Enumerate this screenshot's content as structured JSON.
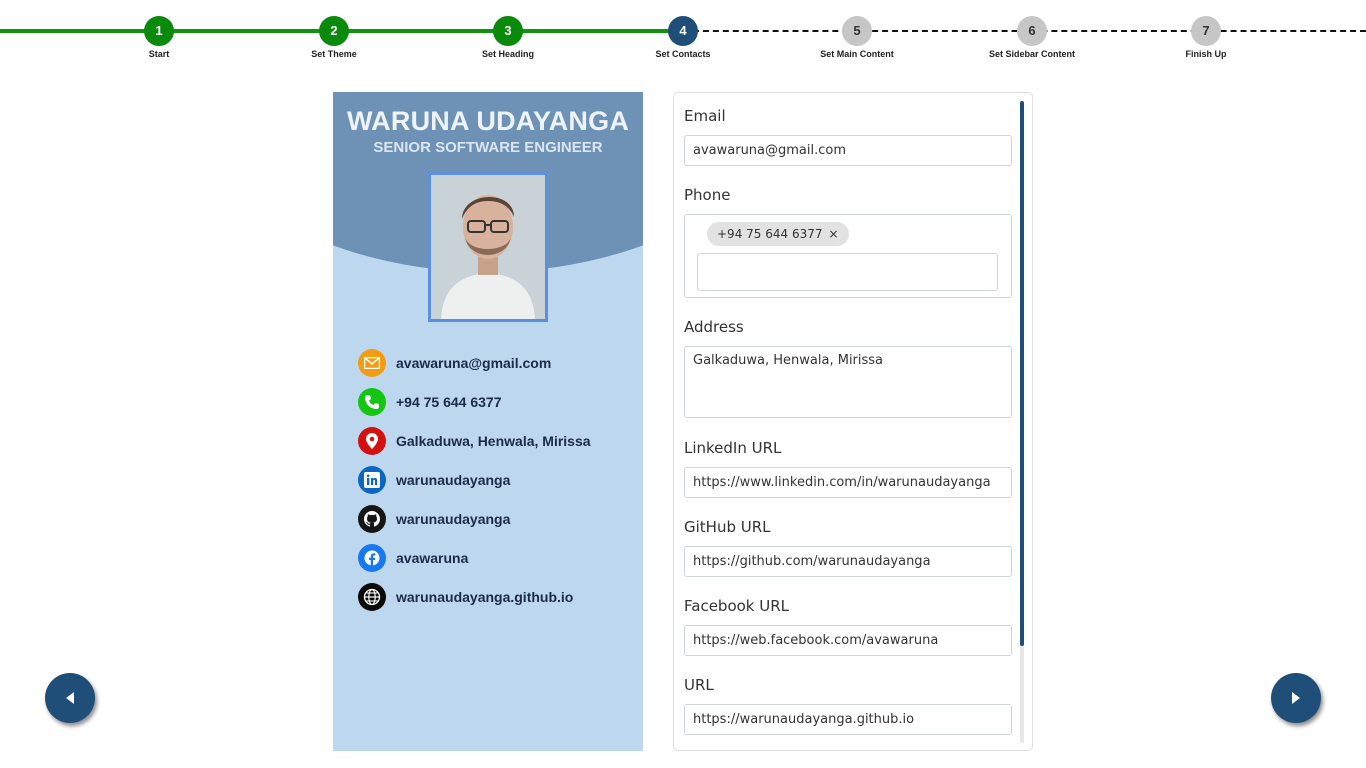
{
  "stepper": {
    "steps": [
      {
        "num": "1",
        "label": "Start",
        "state": "done"
      },
      {
        "num": "2",
        "label": "Set Theme",
        "state": "done"
      },
      {
        "num": "3",
        "label": "Set Heading",
        "state": "done"
      },
      {
        "num": "4",
        "label": "Set Contacts",
        "state": "current"
      },
      {
        "num": "5",
        "label": "Set Main Content",
        "state": "todo"
      },
      {
        "num": "6",
        "label": "Set Sidebar Content",
        "state": "todo"
      },
      {
        "num": "7",
        "label": "Finish Up",
        "state": "todo"
      }
    ]
  },
  "resume": {
    "name": "WARUNA UDAYANGA",
    "title": "SENIOR SOFTWARE ENGINEER",
    "contacts": [
      {
        "icon": "email-icon",
        "text": "avawaruna@gmail.com"
      },
      {
        "icon": "phone-icon",
        "text": "+94 75 644 6377"
      },
      {
        "icon": "location-pin-icon",
        "text": "Galkaduwa, Henwala, Mirissa"
      },
      {
        "icon": "linkedin-icon",
        "text": "warunaudayanga"
      },
      {
        "icon": "github-icon",
        "text": "warunaudayanga"
      },
      {
        "icon": "facebook-icon",
        "text": "avawaruna"
      },
      {
        "icon": "globe-icon",
        "text": "warunaudayanga.github.io"
      }
    ]
  },
  "form": {
    "email_label": "Email",
    "email_value": "avawaruna@gmail.com",
    "phone_label": "Phone",
    "phone_chip": "+94 75 644 6377",
    "phone_chip_remove": "×",
    "address_label": "Address",
    "address_value": "Galkaduwa, Henwala, Mirissa",
    "linkedin_label": "LinkedIn URL",
    "linkedin_value": "https://www.linkedin.com/in/warunaudayanga",
    "github_label": "GitHub URL",
    "github_value": "https://github.com/warunaudayanga",
    "facebook_label": "Facebook URL",
    "facebook_value": "https://web.facebook.com/avawaruna",
    "url_label": "URL",
    "url_value": "https://warunaudayanga.github.io"
  },
  "colors": {
    "done": "#0a8a0a",
    "current": "#1f4e79",
    "todo": "#c6c6c6",
    "resume_bg": "#bdd7ee",
    "banner": "#6e92b5"
  }
}
